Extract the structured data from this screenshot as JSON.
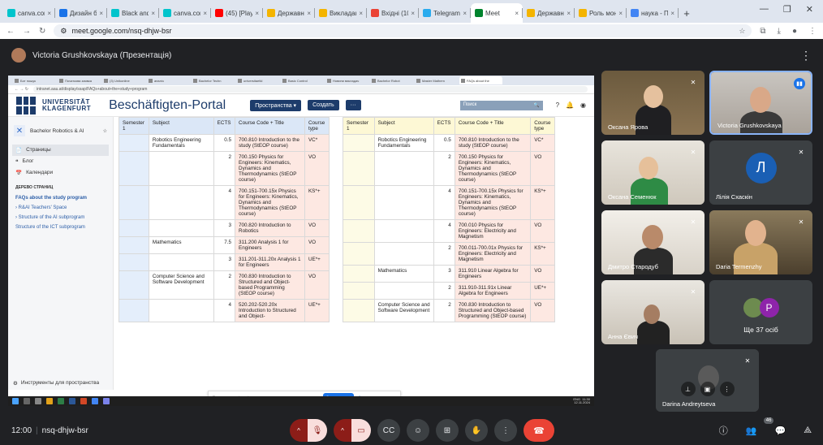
{
  "browser": {
    "tabs": [
      {
        "label": "canva.com",
        "color": "#00c4cc"
      },
      {
        "label": "Дизайн бе",
        "color": "#1a73e8"
      },
      {
        "label": "Black and",
        "color": "#00c4cc"
      },
      {
        "label": "canva.com",
        "color": "#00c4cc"
      },
      {
        "label": "(45) [Playl",
        "color": "#ff0000"
      },
      {
        "label": "Державні",
        "color": "#f4b400"
      },
      {
        "label": "Викладан",
        "color": "#f4b400"
      },
      {
        "label": "Вхідні (10",
        "color": "#ea4335"
      },
      {
        "label": "Telegram",
        "color": "#2aabee"
      },
      {
        "label": "Meet",
        "color": "#00832d"
      },
      {
        "label": "Державн",
        "color": "#f4b400"
      },
      {
        "label": "Роль мон",
        "color": "#f4b400"
      },
      {
        "label": "наука - П",
        "color": "#4285f4"
      }
    ],
    "active_tab": 9,
    "url": "meet.google.com/nsq-dhjw-bsr"
  },
  "meet": {
    "presenter": "Victoria Grushkovskaya (Презентація)",
    "meeting_time": "12:00",
    "meeting_code": "nsq-dhjw-bsr",
    "participant_badge": "46"
  },
  "participants": [
    {
      "name": "Оксана Ярова"
    },
    {
      "name": "Victoria Grushkovskaya"
    },
    {
      "name": "Оксана Семенюк"
    },
    {
      "name": "Лілія Схаскін",
      "initial": "Л"
    },
    {
      "name": "Дмитро Стародуб"
    },
    {
      "name": "Daria Termenzhy"
    },
    {
      "name": "Анна Євич"
    },
    {
      "name": "Ще 37 осіб",
      "initial": "P"
    },
    {
      "name": "Darina Andreytseva"
    }
  ],
  "shared": {
    "inner_tabs": [
      "Бот пошук",
      "Початкова заявка",
      "(3) Unikonline",
      "аналіз",
      "Bachelor Techn",
      "universitaetkl",
      "Basic Control",
      "Новини викладач",
      "Bachelor Robot",
      "Master Mathem",
      "FAQs about the"
    ],
    "inner_url": "intranet.aau.at/display/ssap/FAQs+about+the+study+program",
    "logo_line1": "UNIVERSITÄT",
    "logo_line2": "KLAGENFURT",
    "portal_title": "Beschäftigten-Portal",
    "spaces_btn": "Пространства ▾",
    "create_btn": "Создать",
    "more_btn": "···",
    "search_placeholder": "Поиск",
    "space_name": "Bachelor Robotics & AI",
    "side_items": [
      {
        "icon": "📄",
        "label": "Страницы"
      },
      {
        "icon": "❝",
        "label": "Блог"
      },
      {
        "icon": "📅",
        "label": "Календари"
      }
    ],
    "tree_heading": "ДЕРЕВО СТРАНИЦ",
    "tree_items": [
      "FAQs about the study program",
      "› R&AI Teachers' Space",
      "› Structure of the AI subprogram",
      "Structure of the ICT subprogram"
    ],
    "side_footer": "Инструменты для пространства",
    "notify_text": "Приложение meet.google.com предоставляет доступ к вашему экрану.",
    "notify_btn": "Закрыть доступ",
    "notify_hide": "Скрыть",
    "taskbar_lang": "ENG",
    "taskbar_time": "11:30",
    "taskbar_date": "12.11.2024"
  },
  "table1": {
    "headers": [
      "Semester 1",
      "Subject",
      "ECTS",
      "Course Code + Title",
      "Course type"
    ],
    "rows": [
      {
        "subject": "Robotics Engineering Fundamentals",
        "ects": "0.5",
        "course": "700.810 Introduction to the study (StEOP course)",
        "type": "VC*"
      },
      {
        "subject": "",
        "ects": "2",
        "course": "700.150 Physics for Engineers: Kinematics, Dynamics and Thermodynamics (StEOP course)",
        "type": "VO"
      },
      {
        "subject": "",
        "ects": "4",
        "course": "700.151-700.15x Physics for Engineers: Kinematics, Dynamics and Thermodynamics (StEOP course)",
        "type": "KS*+"
      },
      {
        "subject": "",
        "ects": "3",
        "course": "700.820 Introduction to Robotics",
        "type": "VO"
      },
      {
        "subject": "Mathematics",
        "ects": "7.5",
        "course": "311.200 Analysis 1 for Engineers",
        "type": "VO"
      },
      {
        "subject": "",
        "ects": "3",
        "course": "311.201-311.20x Analysis 1 for Engineers",
        "type": "UE*+"
      },
      {
        "subject": "Computer Science and Software Development",
        "ects": "2",
        "course": "700.830 Introduction to Structured and Object-based Programming (StEOP course)",
        "type": "VO"
      },
      {
        "subject": "",
        "ects": "4",
        "course": "520.202-520.20x Introduction to Structured and Object-",
        "type": "UE*+"
      }
    ]
  },
  "table2": {
    "headers": [
      "Semester 1",
      "Subject",
      "ECTS",
      "Course Code + Title",
      "Course type"
    ],
    "rows": [
      {
        "subject": "Robotics Engineering Fundamentals",
        "ects": "0.5",
        "course": "700.810 Introduction to the study (StEOP course)",
        "type": "VC*"
      },
      {
        "subject": "",
        "ects": "2",
        "course": "700.150 Physics for Engineers: Kinematics, Dynamics and Thermodynamics (StEOP course)",
        "type": "VO"
      },
      {
        "subject": "",
        "ects": "4",
        "course": "700.151-700.15x Physics for Engineers: Kinematics, Dynamics and Thermodynamics (StEOP course)",
        "type": "KS*+"
      },
      {
        "subject": "",
        "ects": "4",
        "course": "700.010 Physics for Engineers: Electricity and Magnetism",
        "type": "VO"
      },
      {
        "subject": "",
        "ects": "2",
        "course": "700.011-700.01x Physics for Engineers: Electricity and Magnetism",
        "type": "KS*+"
      },
      {
        "subject": "Mathematics",
        "ects": "3",
        "course": "311.910 Linear Algebra for Engineers",
        "type": "VO"
      },
      {
        "subject": "",
        "ects": "2",
        "course": "311.910-311.91x Linear Algebra for Engineers",
        "type": "UE*+"
      },
      {
        "subject": "Computer Science and Software Development",
        "ects": "2",
        "course": "700.830 Introduction to Structured and Object-based Programming (StEOP course)",
        "type": "VO"
      }
    ]
  }
}
